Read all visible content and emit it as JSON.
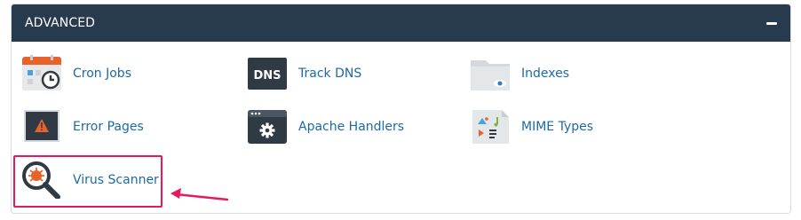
{
  "section": {
    "title": "ADVANCED",
    "collapse_icon": "minus-icon"
  },
  "items": [
    {
      "label": "Cron Jobs",
      "icon": "cron-jobs-icon"
    },
    {
      "label": "Track DNS",
      "icon": "dns-icon"
    },
    {
      "label": "Indexes",
      "icon": "folder-eye-icon"
    },
    {
      "label": "Error Pages",
      "icon": "warning-screen-icon"
    },
    {
      "label": "Apache Handlers",
      "icon": "gear-window-icon"
    },
    {
      "label": "MIME Types",
      "icon": "media-file-icon"
    },
    {
      "label": "Virus Scanner",
      "icon": "magnifier-bug-icon"
    }
  ],
  "colors": {
    "header_bg": "#283a4d",
    "link": "#1b6aa5",
    "highlight": "#e8185f",
    "accent_orange": "#e8622c"
  }
}
